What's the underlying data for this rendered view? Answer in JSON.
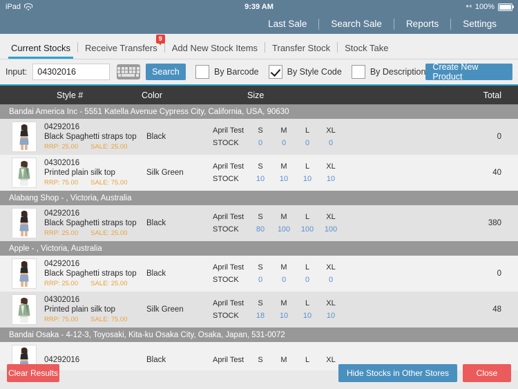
{
  "statusbar": {
    "device": "iPad",
    "time": "9:39 AM",
    "battery_percent": "100%",
    "wifi_icon": "wifi-icon",
    "bluetooth_icon": "bluetooth-icon",
    "battery_icon": "battery-icon"
  },
  "navbar": {
    "items": [
      {
        "label": "Last Sale"
      },
      {
        "label": "Search Sale"
      },
      {
        "label": "Reports"
      },
      {
        "label": "Settings"
      }
    ]
  },
  "tabs": [
    {
      "label": "Current Stocks",
      "active": true,
      "badge": ""
    },
    {
      "label": "Receive Transfers",
      "active": false,
      "badge": "9"
    },
    {
      "label": "Add New Stock Items",
      "active": false,
      "badge": ""
    },
    {
      "label": "Transfer Stock",
      "active": false,
      "badge": ""
    },
    {
      "label": "Stock Take",
      "active": false,
      "badge": ""
    }
  ],
  "search": {
    "input_label": "Input:",
    "input_value": "04302016",
    "input_placeholder": "",
    "keyboard_icon": "keyboard-icon",
    "search_button": "Search",
    "by_barcode": {
      "label": "By Barcode",
      "checked": false
    },
    "by_style_code": {
      "label": "By Style Code",
      "checked": true
    },
    "by_description": {
      "label": "By Description",
      "checked": false
    },
    "create_button": "Create New Product"
  },
  "table": {
    "columns": {
      "style": "Style #",
      "color": "Color",
      "size": "Size",
      "total": "Total"
    },
    "size_label": "April Test",
    "stock_label": "STOCK",
    "size_headers": [
      "S",
      "M",
      "L",
      "XL"
    ],
    "rrp_label": "RRP:",
    "sale_label": "SALE:",
    "groups": [
      {
        "header": "Bandai America Inc - 5551 Katella Avenue Cypress City, California, USA, 90630",
        "rows": [
          {
            "sku": "04292016",
            "desc": "Black Spaghetti straps top",
            "rrp": "25.00",
            "sale": "25.00",
            "color": "Black",
            "size_label": "April Test",
            "sizes": [
              "S",
              "M",
              "L",
              "XL"
            ],
            "stock": [
              "0",
              "0",
              "0",
              "0"
            ],
            "total": "0",
            "thumb": "model-black-top"
          },
          {
            "sku": "04302016",
            "desc": "Printed plain silk top",
            "rrp": "75.00",
            "sale": "75.00",
            "color": "Silk Green",
            "size_label": "April Test",
            "sizes": [
              "S",
              "M",
              "L",
              "XL"
            ],
            "stock": [
              "10",
              "10",
              "10",
              "10"
            ],
            "total": "40",
            "thumb": "model-silk-top"
          }
        ]
      },
      {
        "header": "Alabang Shop - , Victoria, Australia",
        "rows": [
          {
            "sku": "04292016",
            "desc": "Black Spaghetti straps top",
            "rrp": "25.00",
            "sale": "25.00",
            "color": "Black",
            "size_label": "April Test",
            "sizes": [
              "S",
              "M",
              "L",
              "XL"
            ],
            "stock": [
              "80",
              "100",
              "100",
              "100"
            ],
            "total": "380",
            "thumb": "model-black-top"
          }
        ]
      },
      {
        "header": "Apple - , Victoria, Australia",
        "rows": [
          {
            "sku": "04292016",
            "desc": "Black Spaghetti straps top",
            "rrp": "25.00",
            "sale": "25.00",
            "color": "Black",
            "size_label": "April Test",
            "sizes": [
              "S",
              "M",
              "L",
              "XL"
            ],
            "stock": [
              "0",
              "0",
              "0",
              "0"
            ],
            "total": "0",
            "thumb": "model-black-top"
          },
          {
            "sku": "04302016",
            "desc": "Printed plain silk top",
            "rrp": "75.00",
            "sale": "75.00",
            "color": "Silk Green",
            "size_label": "April Test",
            "sizes": [
              "S",
              "M",
              "L",
              "XL"
            ],
            "stock": [
              "18",
              "10",
              "10",
              "10"
            ],
            "total": "48",
            "thumb": "model-silk-top"
          }
        ]
      },
      {
        "header": "Bandai Osaka - 4-12-3, Toyosaki, Kita-ku Osaka City, Osaka, Japan, 531-0072",
        "rows": [
          {
            "sku": "04292016",
            "desc": "",
            "rrp": "",
            "sale": "",
            "color": "Black",
            "size_label": "April Test",
            "sizes": [
              "S",
              "M",
              "L",
              "XL"
            ],
            "stock": [],
            "total": "",
            "thumb": "model-black-top"
          }
        ]
      }
    ]
  },
  "footer": {
    "clear_button": "Clear Results",
    "hide_button": "Hide Stocks in Other Stores",
    "close_button": "Close"
  },
  "colors": {
    "navbar": "#5e7e96",
    "accent": "#29a3d0",
    "blue_button": "#4a90bf",
    "red_button": "#ec5b5b",
    "badge_red": "#e8413d",
    "price_orange": "#e8a33d",
    "stock_blue": "#5b8fd0",
    "column_header": "#3b3b3b",
    "group_header": "#989898"
  }
}
